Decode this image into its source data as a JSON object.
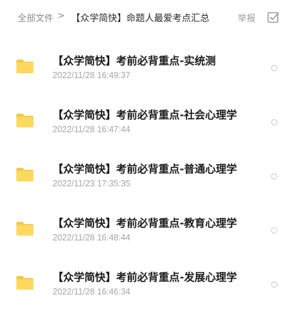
{
  "breadcrumb": {
    "root": "全部文件",
    "separator": ">",
    "current": "【众学简快】命题人最爱考点汇总"
  },
  "actions": {
    "report": "举报",
    "select_icon": "checkbox-edit-icon"
  },
  "colors": {
    "folder": "#ffd860",
    "folder_tab": "#f5c842",
    "date_text": "#a6a6a6",
    "title_text": "#1c1c1c"
  },
  "files": [
    {
      "name": "【众学简快】考前必背重点-实统测",
      "date": "2022/11/28 16:49:37",
      "icon": "folder-icon"
    },
    {
      "name": "【众学简快】考前必背重点-社会心理学",
      "date": "2022/11/28 16:47:44",
      "icon": "folder-icon"
    },
    {
      "name": "【众学简快】考前必背重点-普通心理学",
      "date": "2022/11/23 17:35:35",
      "icon": "folder-icon"
    },
    {
      "name": "【众学简快】考前必背重点-教育心理学",
      "date": "2022/11/28 16:48:44",
      "icon": "folder-icon"
    },
    {
      "name": "【众学简快】考前必背重点-发展心理学",
      "date": "2022/11/28 16:46:34",
      "icon": "folder-icon"
    }
  ]
}
